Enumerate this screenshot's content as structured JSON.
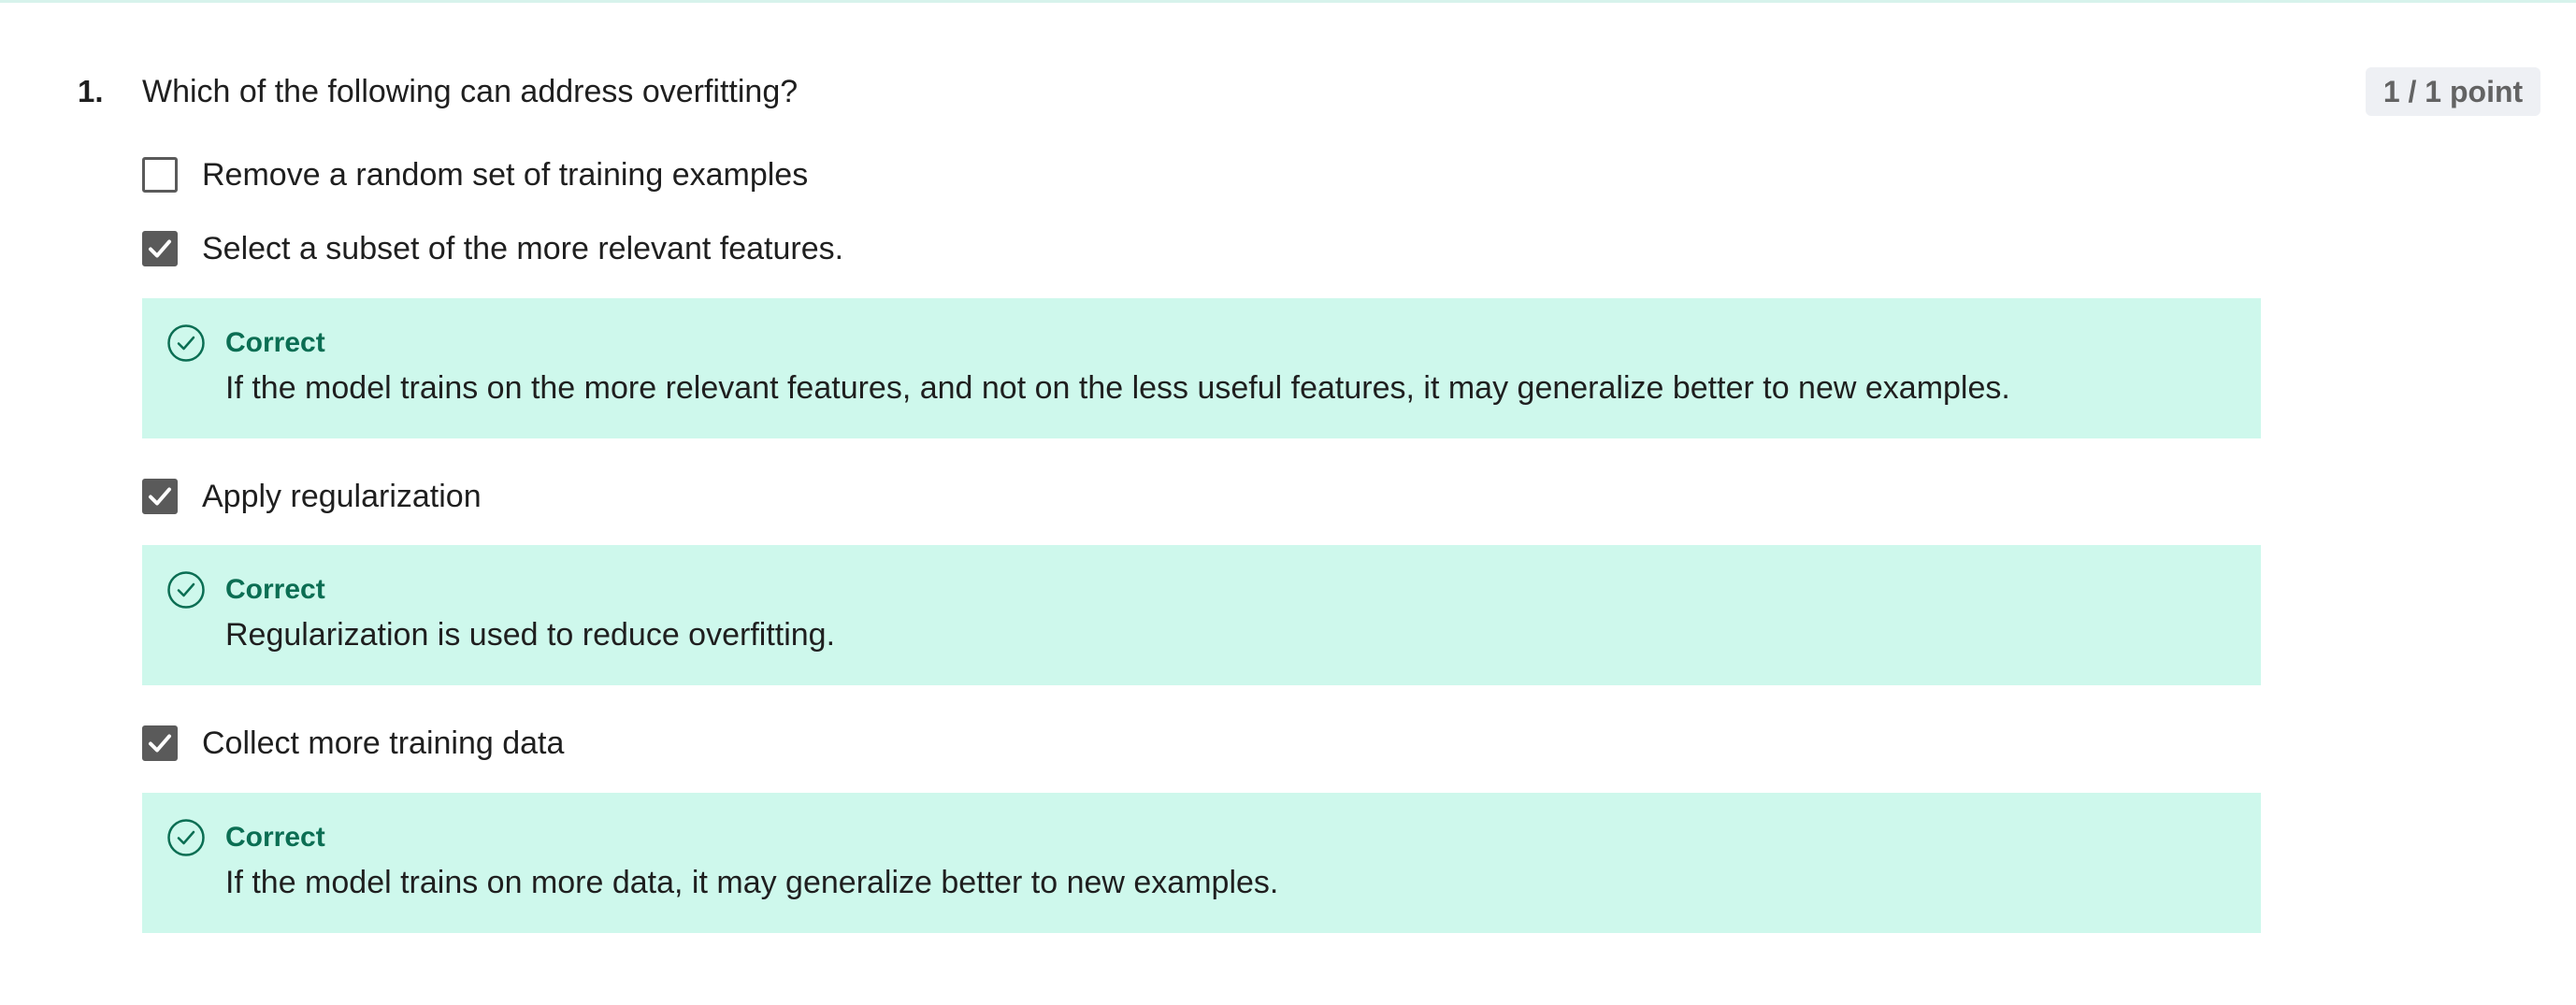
{
  "question": {
    "number": "1.",
    "text": "Which of the following can address overfitting?",
    "points": "1 / 1 point"
  },
  "options": [
    {
      "label": "Remove a random set of training examples",
      "checked": false
    },
    {
      "label": "Select a subset of the more relevant features.",
      "checked": true,
      "feedback": {
        "status": "Correct",
        "text": "If the model trains on the more relevant features, and not on the less useful features, it may generalize better to new examples."
      }
    },
    {
      "label": "Apply regularization",
      "checked": true,
      "feedback": {
        "status": "Correct",
        "text": "Regularization is used to reduce overfitting."
      }
    },
    {
      "label": "Collect more training data",
      "checked": true,
      "feedback": {
        "status": "Correct",
        "text": "If the model trains on more data, it may generalize better to new examples."
      }
    }
  ],
  "colors": {
    "feedback_bg": "#cef8ec",
    "correct_green": "#0b6e53",
    "checkbox_checked": "#5a5a5a",
    "points_badge_bg": "#eef0f4"
  },
  "icons": {
    "checkbox_checked": "checkmark-icon",
    "feedback_status": "check-circle-icon"
  }
}
